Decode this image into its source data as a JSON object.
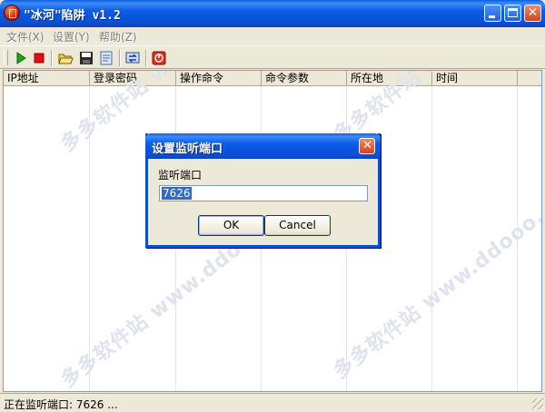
{
  "window": {
    "title": "\"冰河\"陷阱 v1.2"
  },
  "menu": [
    "文件(X)",
    "设置(Y)",
    "帮助(Z)"
  ],
  "toolbar": {
    "icons": [
      "start-icon",
      "stop-icon",
      "open-folder-icon",
      "save-icon",
      "clear-icon",
      "refresh-icon",
      "exit-icon"
    ]
  },
  "list": {
    "columns": [
      "IP地址",
      "登录密码",
      "操作命令",
      "命令参数",
      "所在地",
      "时间"
    ]
  },
  "watermark": "多多软件站 www.ddooo.com",
  "status": {
    "text": "正在监听端口: 7626 ..."
  },
  "dialog": {
    "title": "设置监听端口",
    "label": "监听端口",
    "port_value": "7626",
    "ok_label": "OK",
    "cancel_label": "Cancel"
  },
  "colors": {
    "titlebar": "#0a4fd6",
    "selection": "#316ac5",
    "face": "#ece9d8"
  }
}
